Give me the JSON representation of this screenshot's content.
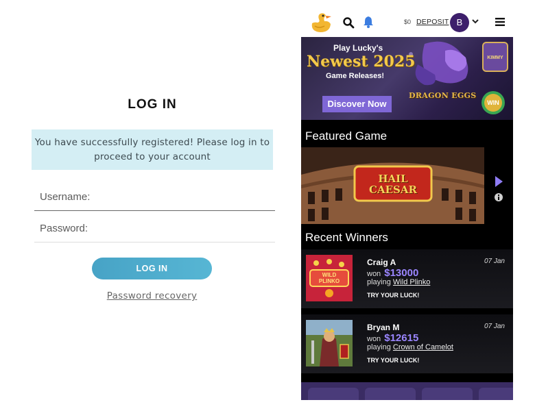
{
  "login": {
    "title": "LOG IN",
    "success_message": "You have successfully registered! Please log in to proceed to your account",
    "username_placeholder": "Username:",
    "password_placeholder": "Password:",
    "login_button": "LOG IN",
    "password_recovery": "Password recovery"
  },
  "casino": {
    "header": {
      "logo": "duck-icon",
      "balance": "$0",
      "deposit_label": "DEPOSIT",
      "avatar_initial": "B"
    },
    "promo": {
      "line1": "Play Lucky's",
      "line2": "Newest 2025",
      "line3": "Game Releases!",
      "button": "Discover Now",
      "game_logo": "DRAGON EGGS"
    },
    "featured": {
      "title": "Featured Game",
      "game_logo": "HAIL CAESAR"
    },
    "winners": {
      "title": "Recent Winners",
      "won_prefix": "won",
      "playing_prefix": "playing",
      "cta": "TRY YOUR LUCK!",
      "items": [
        {
          "name": "Craig A",
          "date": "07 Jan",
          "amount": "$13000",
          "game": "Wild Plinko",
          "thumb_text": "WILD PLINKO"
        },
        {
          "name": "Bryan M",
          "date": "07 Jan",
          "amount": "$12615",
          "game": "Crown of Camelot",
          "thumb_text": ""
        }
      ]
    },
    "colors": {
      "accent": "#7f67d6",
      "amount": "#9b86ff",
      "login_button": "#4aa8c9"
    }
  }
}
